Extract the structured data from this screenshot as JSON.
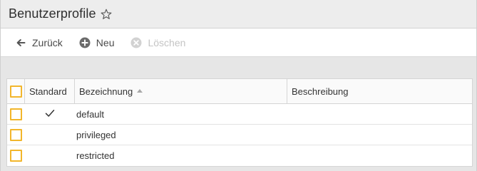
{
  "window": {
    "title": "Benutzerprofile"
  },
  "toolbar": {
    "back_label": "Zurück",
    "new_label": "Neu",
    "delete_label": "Löschen"
  },
  "table": {
    "columns": {
      "standard": "Standard",
      "bezeichnung": "Bezeichnung",
      "beschreibung": "Beschreibung"
    },
    "sort": {
      "column": "bezeichnung",
      "direction": "ascending"
    },
    "rows": [
      {
        "standard": true,
        "bezeichnung": "default",
        "beschreibung": ""
      },
      {
        "standard": false,
        "bezeichnung": "privileged",
        "beschreibung": ""
      },
      {
        "standard": false,
        "bezeichnung": "restricted",
        "beschreibung": ""
      }
    ]
  },
  "icons": {
    "favorite": "star-outline-icon",
    "back": "arrow-left-icon",
    "new": "plus-circle-icon",
    "delete": "x-circle-icon",
    "sort": "sort-ascending-icon",
    "standard_mark": "checkmark-icon"
  },
  "colors": {
    "checkbox_border": "#f2b62c",
    "disabled_text": "#c4c4c4"
  }
}
